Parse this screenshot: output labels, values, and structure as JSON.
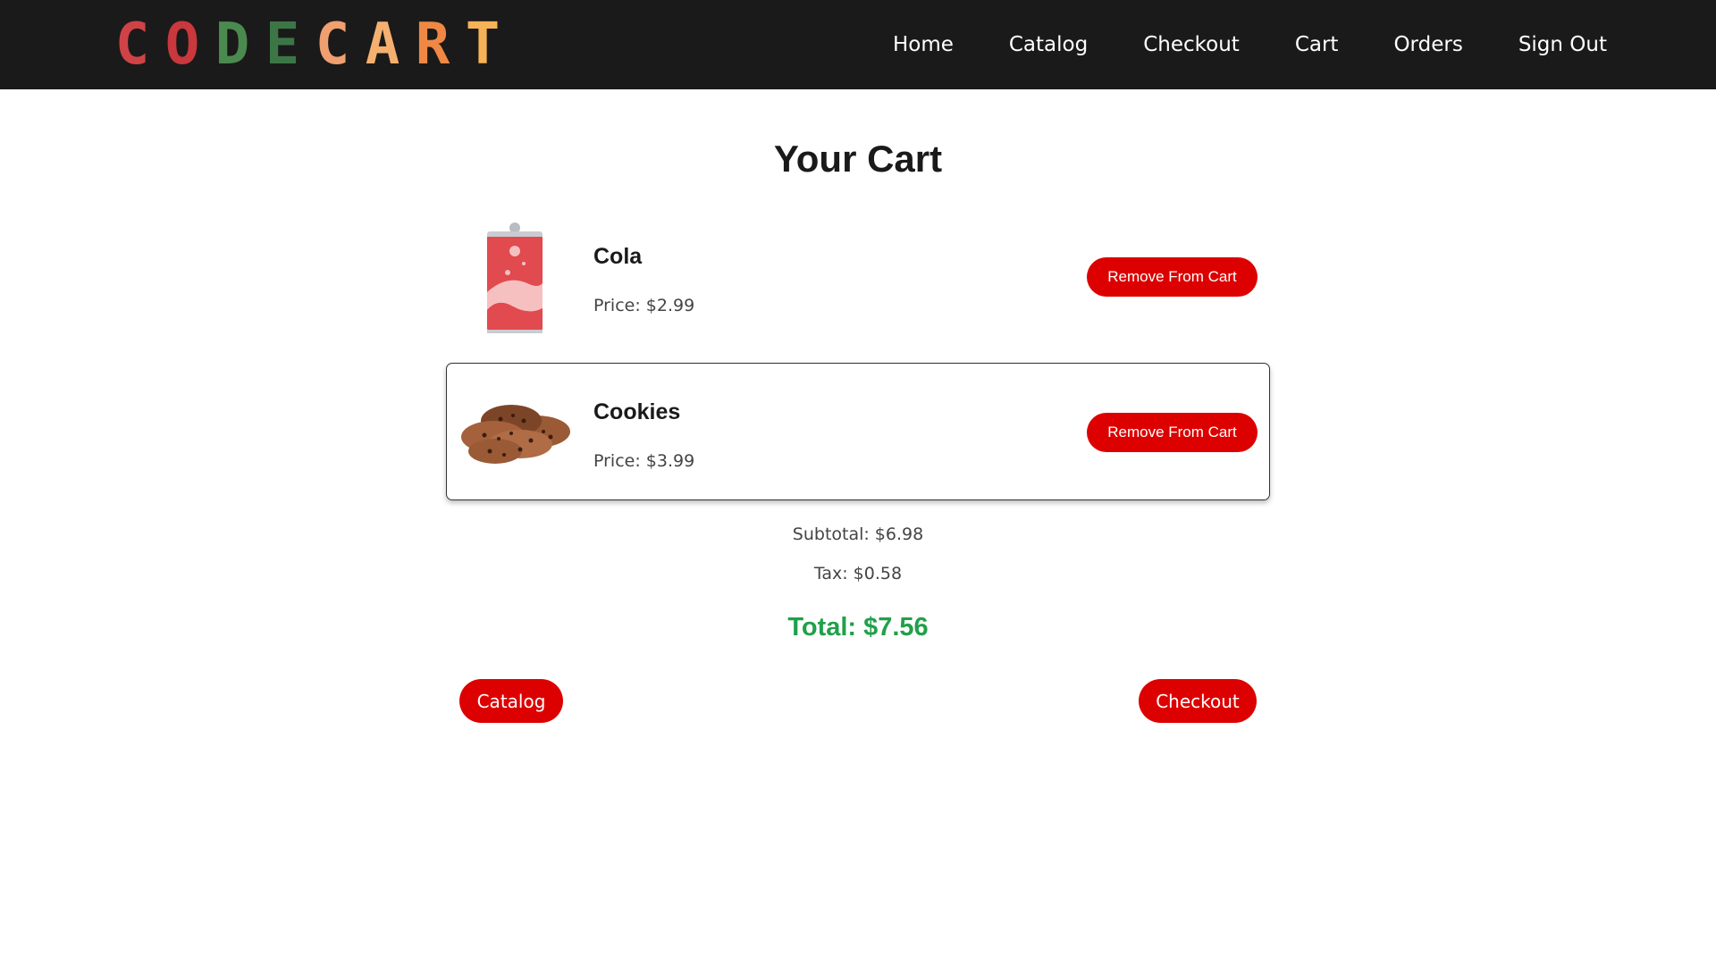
{
  "brand": {
    "wordmark": "CODECART",
    "letter_colors": [
      "#cf4347",
      "#cf4347",
      "#3f7a4a",
      "#3f7a4a",
      "#f0a070",
      "#f2a15a",
      "#f08a45",
      "#f6b256"
    ]
  },
  "nav": {
    "items": [
      "Home",
      "Catalog",
      "Checkout",
      "Cart",
      "Orders",
      "Sign Out"
    ]
  },
  "page": {
    "title": "Your Cart"
  },
  "cart": {
    "items": [
      {
        "name": "Cola",
        "price_label": "Price:",
        "price": "$2.99",
        "image_icon": "soda-can-icon",
        "remove_label": "Remove From Cart",
        "hovered": false
      },
      {
        "name": "Cookies",
        "price_label": "Price:",
        "price": "$3.99",
        "image_icon": "cookies-icon",
        "remove_label": "Remove From Cart",
        "hovered": true
      }
    ]
  },
  "summary": {
    "subtotal_label": "Subtotal:",
    "subtotal": "$6.98",
    "tax_label": "Tax:",
    "tax": "$0.58",
    "total_label": "Total:",
    "total": "$7.56"
  },
  "actions": {
    "catalog_label": "Catalog",
    "checkout_label": "Checkout"
  },
  "colors": {
    "header_bg": "#1b1a1a",
    "button_red": "#dd0000",
    "total_green": "#21a04a"
  }
}
